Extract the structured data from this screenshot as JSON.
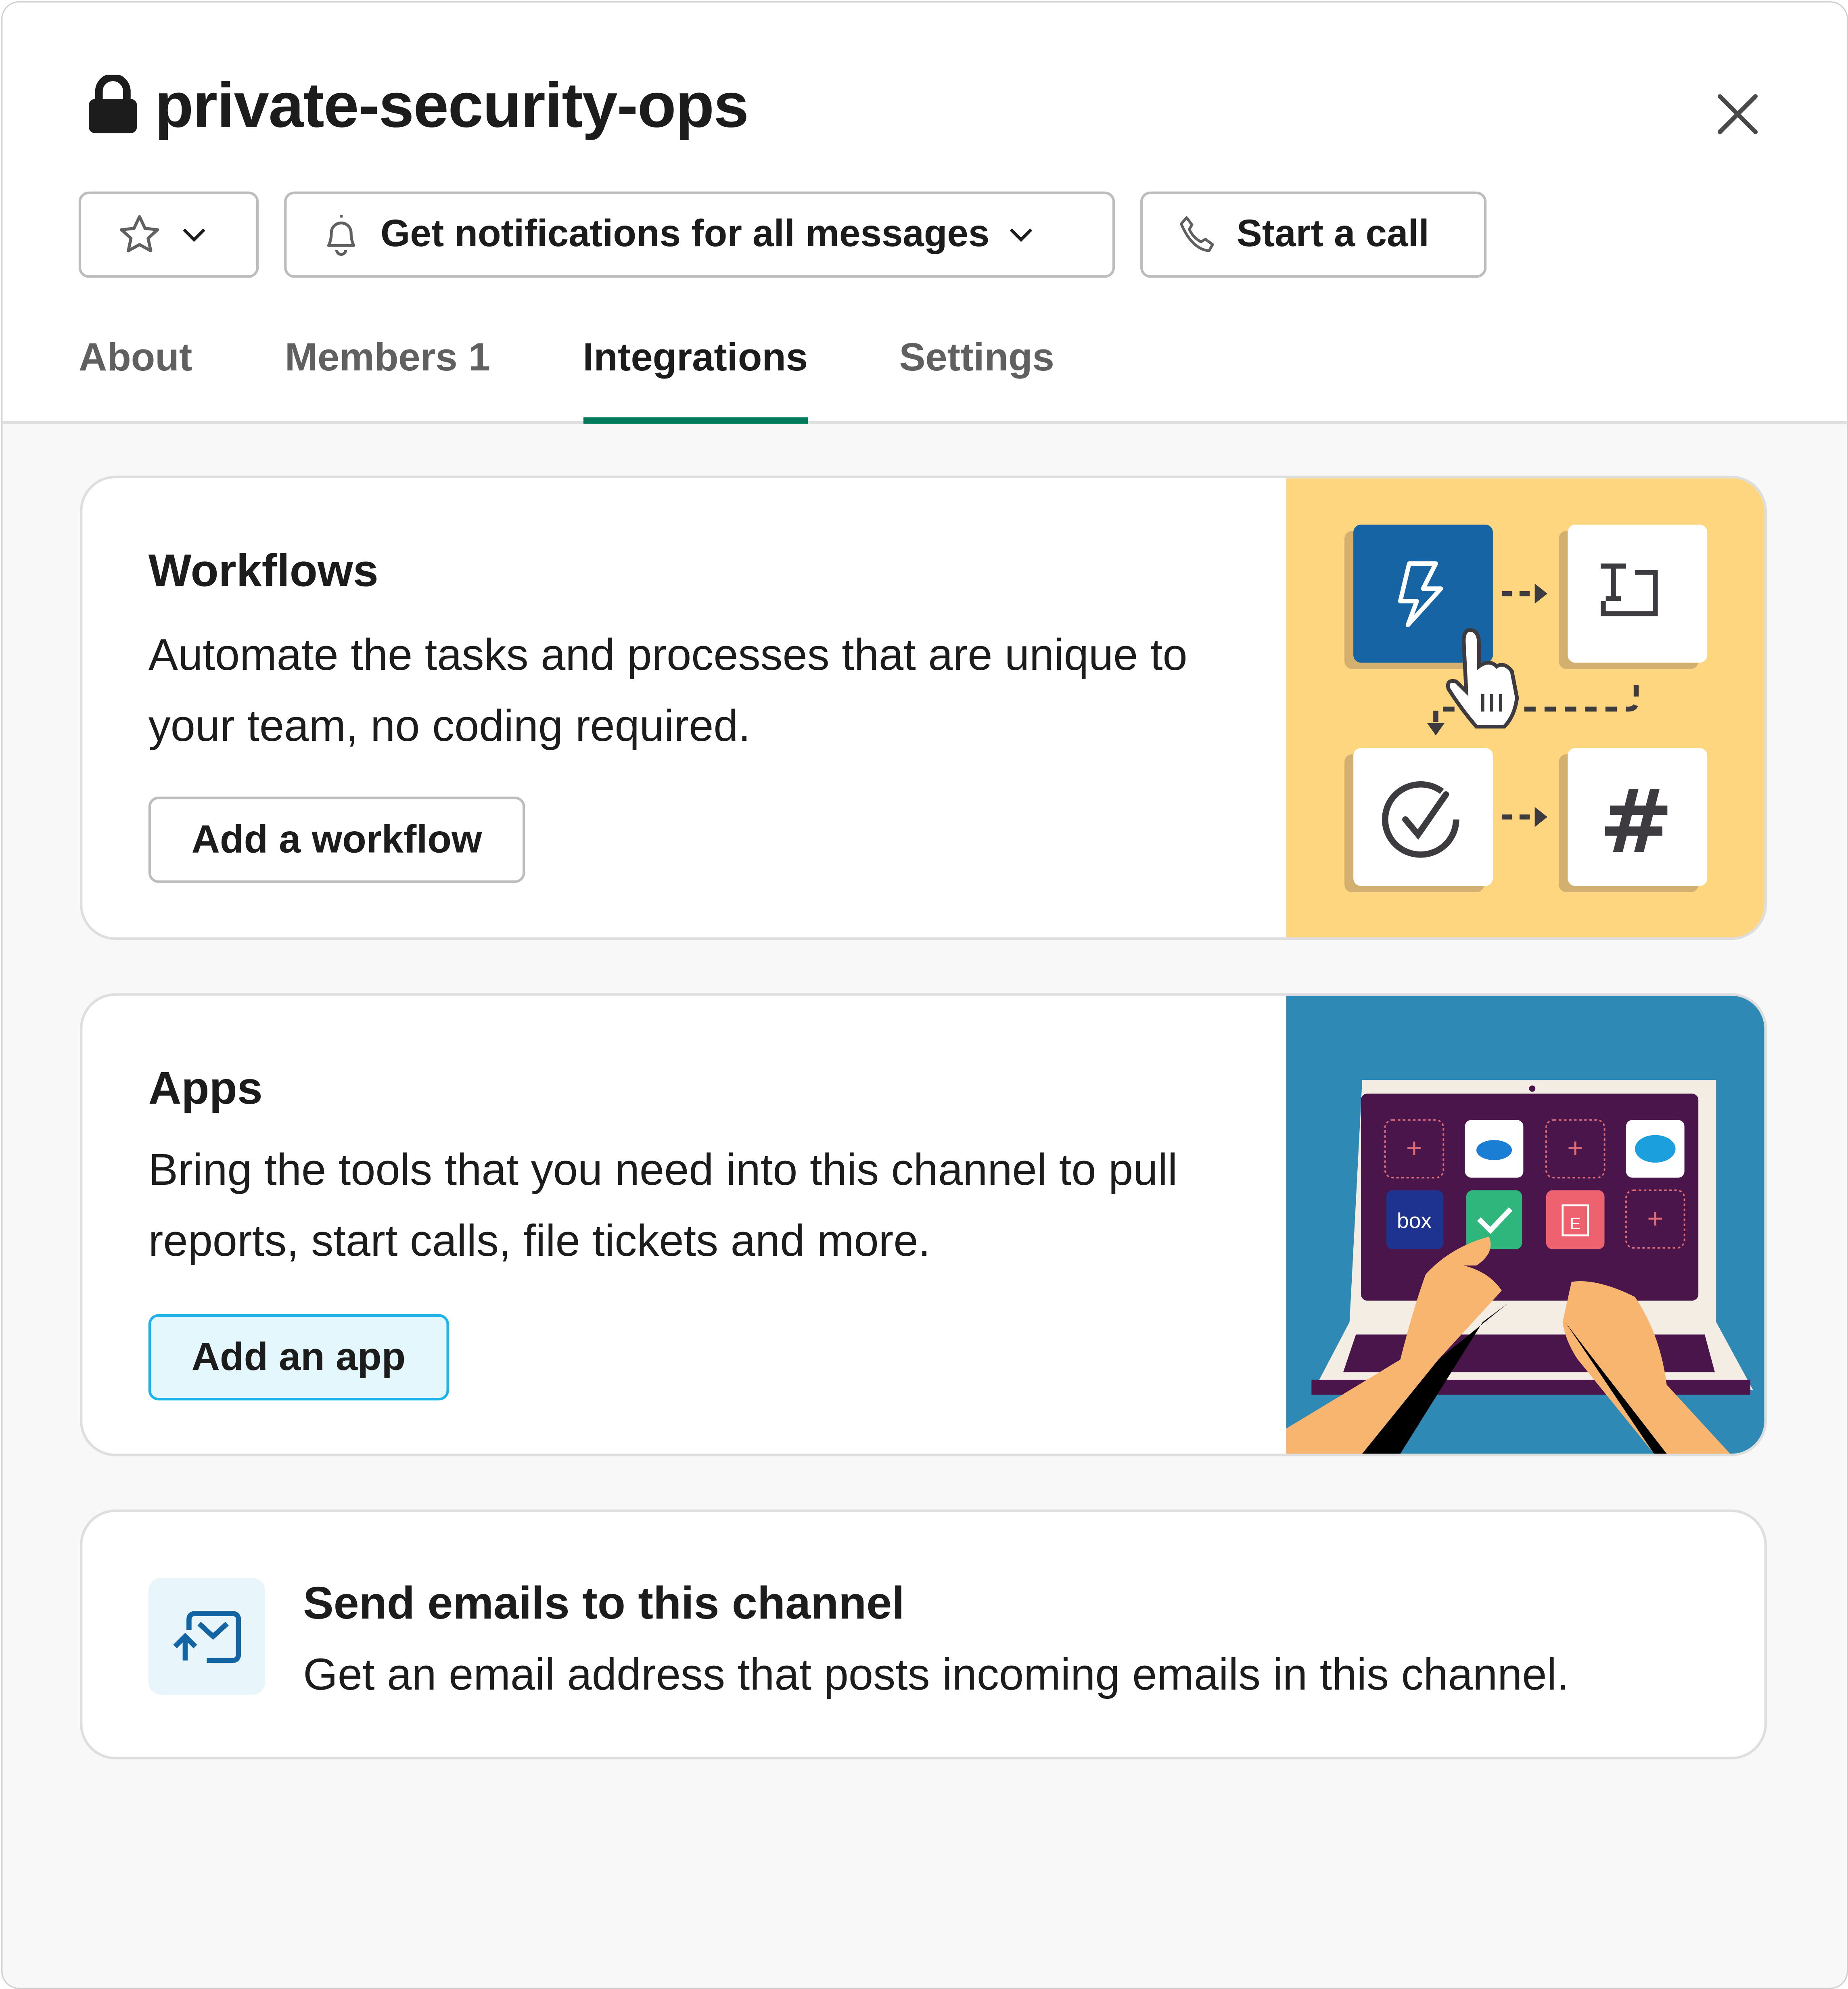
{
  "header": {
    "channel_name": "private-security-ops",
    "lock_icon": "lock-icon",
    "close_icon": "close-icon"
  },
  "toolbar": {
    "star_button_icons": [
      "star-icon",
      "chevron-down-icon"
    ],
    "notifications_label": "Get notifications for all messages",
    "call_label": "Start a call"
  },
  "tabs": [
    {
      "label": "About",
      "active": false
    },
    {
      "label": "Members 1",
      "active": false
    },
    {
      "label": "Integrations",
      "active": true
    },
    {
      "label": "Settings",
      "active": false
    }
  ],
  "cards": {
    "workflows": {
      "title": "Workflows",
      "description": "Automate the tasks and processes that are unique to your team, no coding required.",
      "button": "Add a workflow"
    },
    "apps": {
      "title": "Apps",
      "description": "Bring the tools that you need into this channel to pull reports, start calls, file tickets and more.",
      "button": "Add an app",
      "illustration_apps": [
        "onedrive",
        "salesforce",
        "box",
        "checkmark",
        "evernote-style"
      ]
    },
    "email": {
      "title": "Send emails to this channel",
      "description": "Get an email address that posts incoming emails in this channel."
    }
  },
  "colors": {
    "accent_tab": "#007a5a",
    "workflow_bg": "#fdd67f",
    "workflow_blue": "#1664a3",
    "apps_bg": "#2f89b5",
    "laptop_screen": "#4a154b",
    "highlight_button_bg": "#e3f7fd",
    "highlight_button_border": "#1cb4e8"
  }
}
